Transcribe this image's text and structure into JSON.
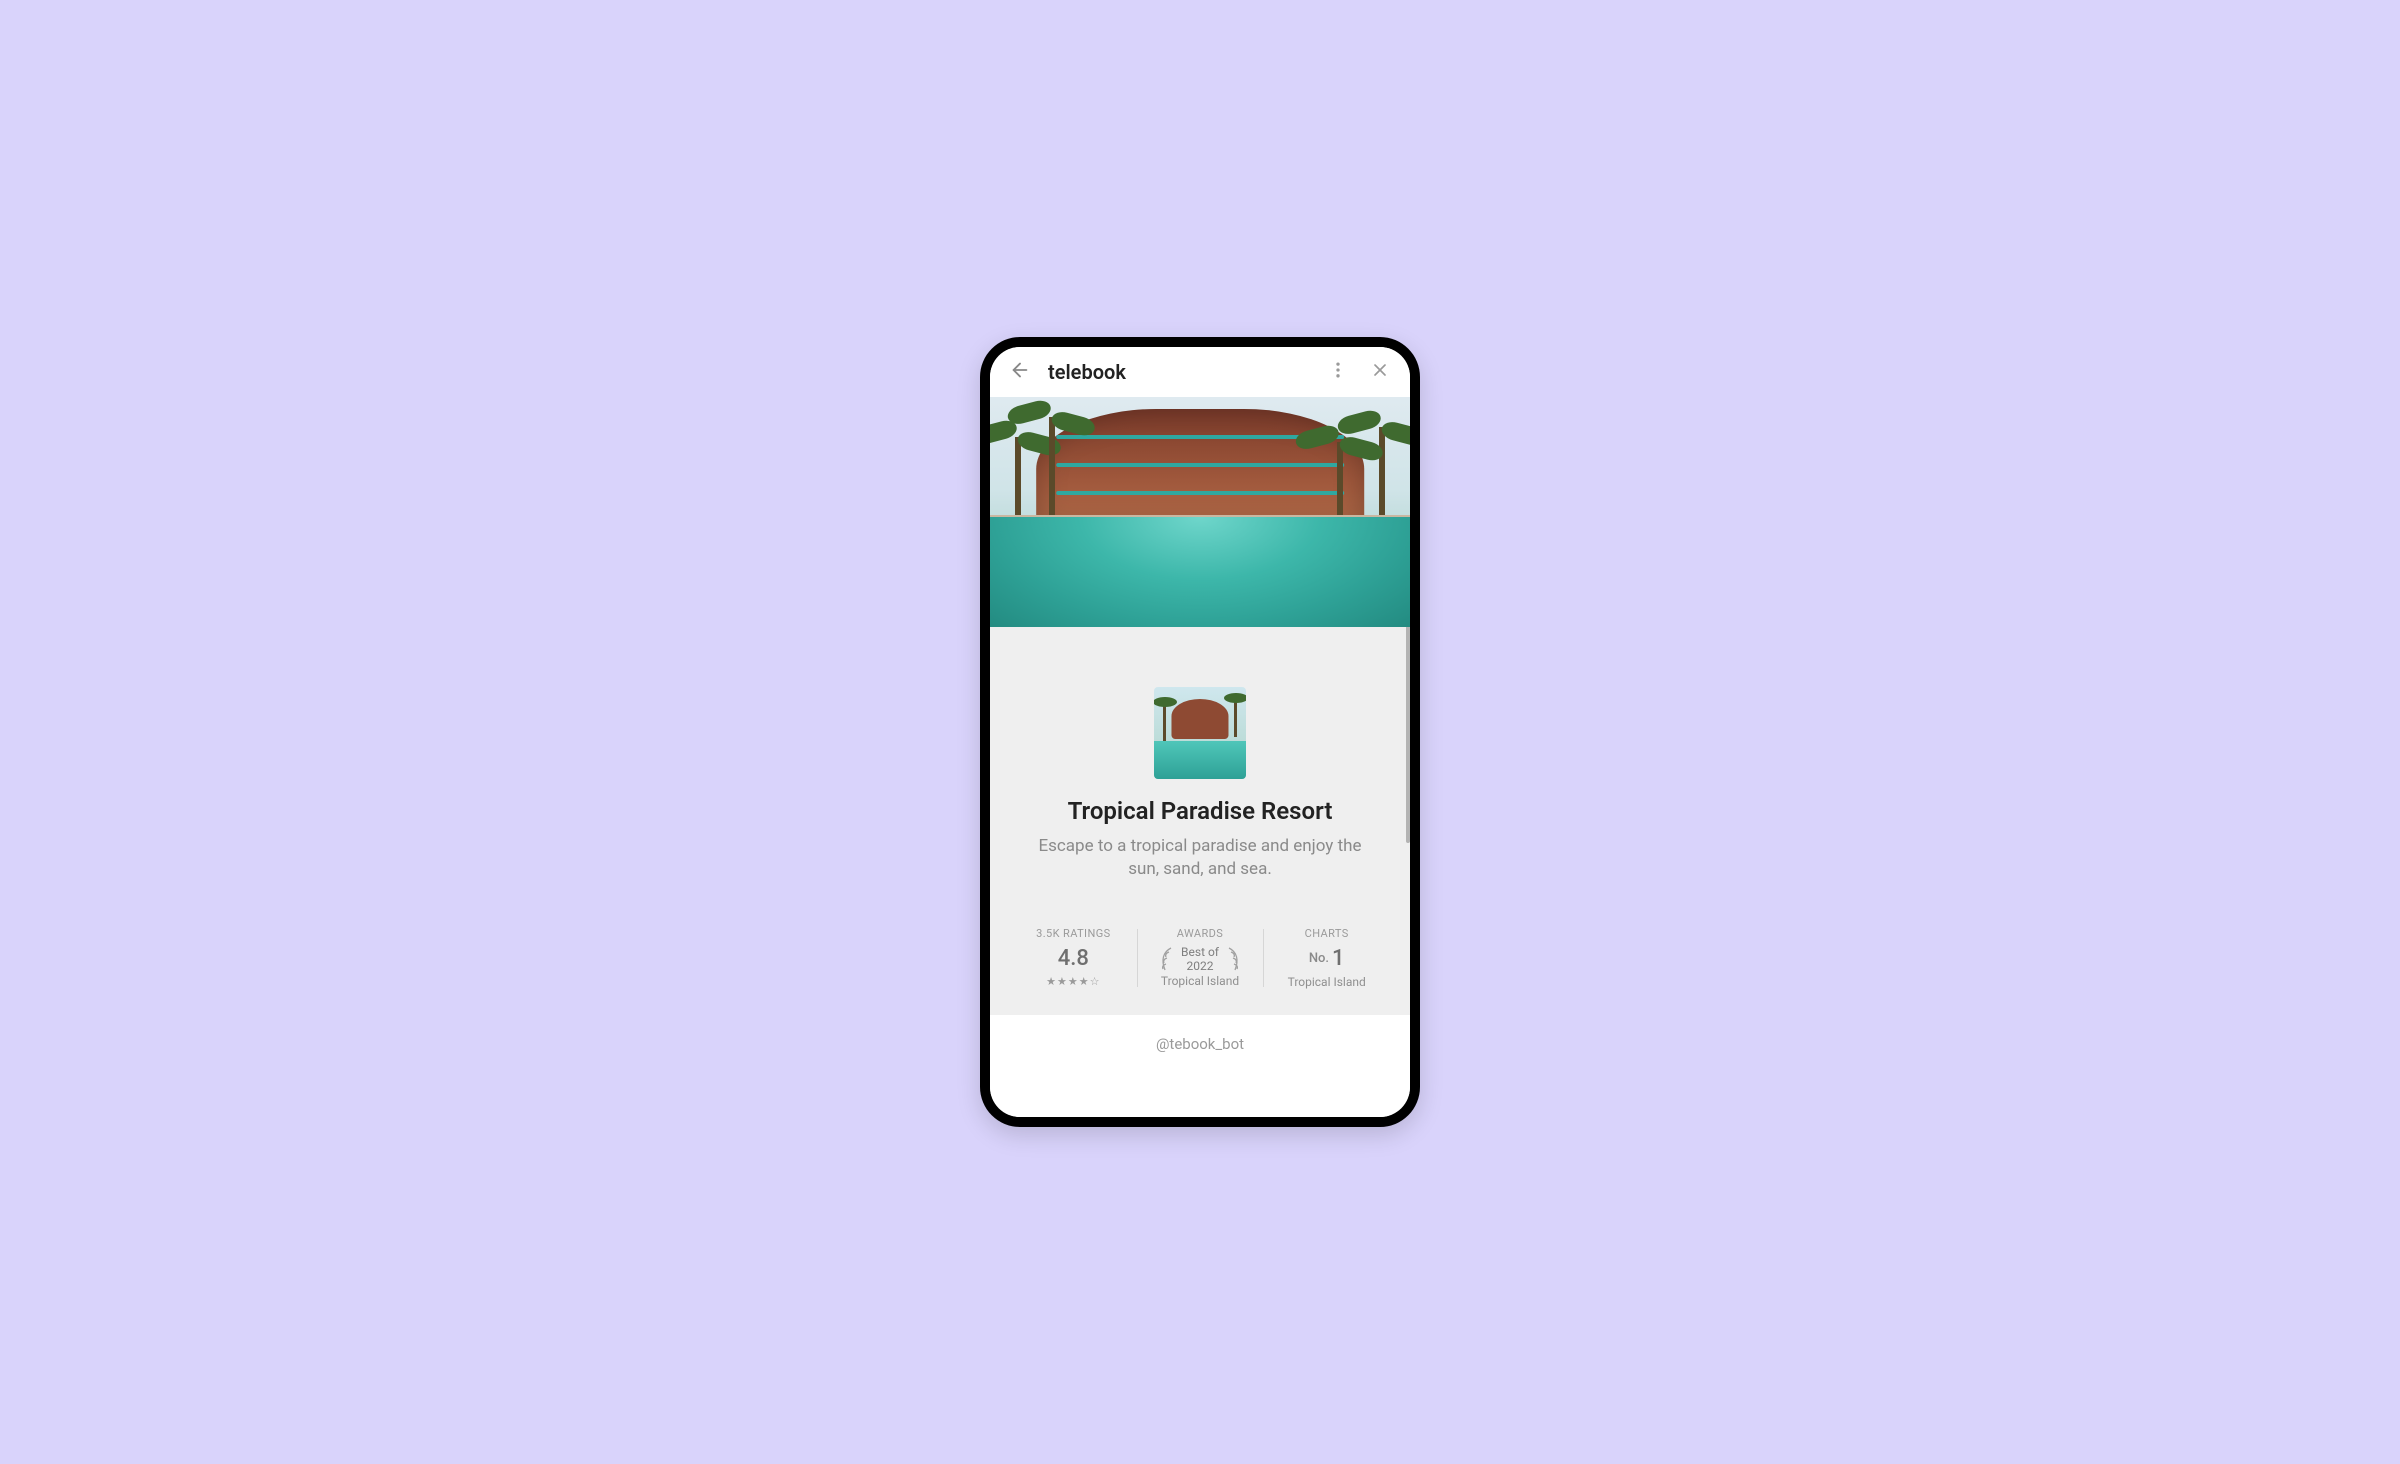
{
  "header": {
    "title": "telebook"
  },
  "hotel": {
    "name": "Tropical Paradise Resort",
    "description": "Escape to a tropical paradise and enjoy the sun, sand, and sea."
  },
  "stats": {
    "ratings": {
      "label": "3.5K RATINGS",
      "value": "4.8",
      "stars": "★★★★☆"
    },
    "awards": {
      "label": "AWARDS",
      "line1": "Best of",
      "line2": "2022",
      "sub": "Tropical Island"
    },
    "charts": {
      "label": "CHARTS",
      "prefix": "No.",
      "value": "1",
      "sub": "Tropical Island"
    }
  },
  "footer": {
    "handle": "@tebook_bot"
  }
}
